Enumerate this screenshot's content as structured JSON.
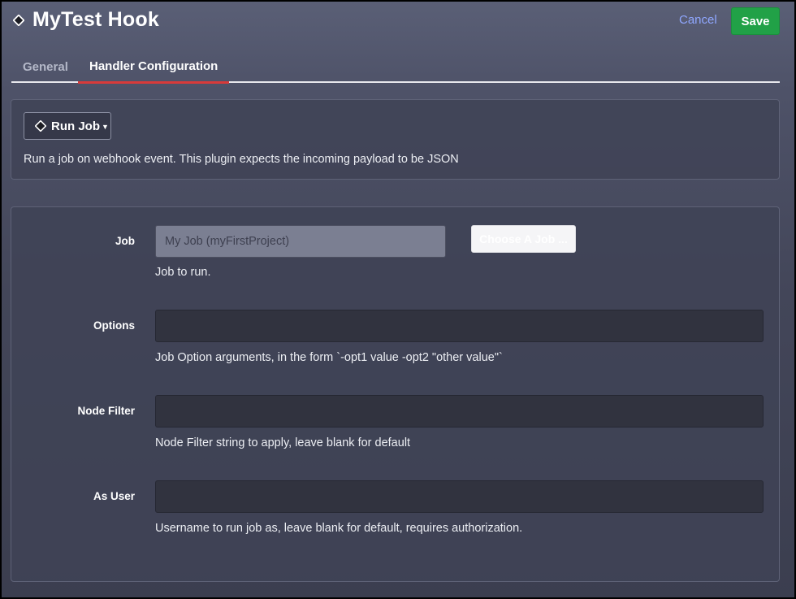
{
  "header": {
    "title": "MyTest Hook",
    "cancel_label": "Cancel",
    "save_label": "Save"
  },
  "tabs": [
    {
      "label": "General",
      "active": false
    },
    {
      "label": "Handler Configuration",
      "active": true
    }
  ],
  "handler": {
    "selector_label": "Run Job",
    "description": "Run a job on webhook event. This plugin expects the incoming payload to be JSON"
  },
  "form": {
    "job": {
      "label": "Job",
      "value": "My Job (myFirstProject)",
      "choose_label": "Choose A Job ...",
      "help": "Job to run."
    },
    "options": {
      "label": "Options",
      "value": "",
      "help": "Job Option arguments, in the form `-opt1 value -opt2 \"other value\"`"
    },
    "node_filter": {
      "label": "Node Filter",
      "value": "",
      "help": "Node Filter string to apply, leave blank for default"
    },
    "as_user": {
      "label": "As User",
      "value": "",
      "help": "Username to run job as, leave blank for default, requires authorization."
    }
  },
  "colors": {
    "save": "#21a147",
    "cancel": "#8fa7ff",
    "active_tab_underline": "#d83a3a",
    "background": "#474a5e"
  },
  "icons": {
    "title": "diamond-icon",
    "handler": "diamond-icon",
    "dropdown": "caret-down-icon"
  }
}
